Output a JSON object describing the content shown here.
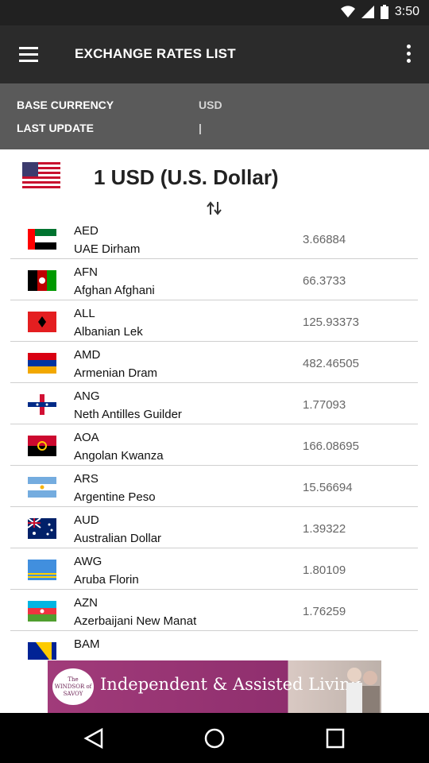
{
  "status_bar": {
    "time": "3:50"
  },
  "toolbar": {
    "title": "EXCHANGE RATES LIST",
    "menu_icon": "hamburger-menu-icon",
    "overflow_icon": "more-vert-icon"
  },
  "info": {
    "base_currency_label": "BASE CURRENCY",
    "base_currency_value": "USD",
    "last_update_label": "LAST UPDATE",
    "last_update_value": "|"
  },
  "base": {
    "title": "1 USD (U.S. Dollar)",
    "flag_icon": "us-flag-icon",
    "swap_icon": "swap-vertical-icon"
  },
  "rates": [
    {
      "code": "AED",
      "name": "UAE Dirham",
      "rate": "3.66884",
      "flag_icon": "uae-flag-icon"
    },
    {
      "code": "AFN",
      "name": "Afghan Afghani",
      "rate": "66.3733",
      "flag_icon": "afghanistan-flag-icon"
    },
    {
      "code": "ALL",
      "name": "Albanian Lek",
      "rate": "125.93373",
      "flag_icon": "albania-flag-icon"
    },
    {
      "code": "AMD",
      "name": "Armenian Dram",
      "rate": "482.46505",
      "flag_icon": "armenia-flag-icon"
    },
    {
      "code": "ANG",
      "name": "Neth Antilles Guilder",
      "rate": "1.77093",
      "flag_icon": "netherlands-antilles-flag-icon"
    },
    {
      "code": "AOA",
      "name": "Angolan Kwanza",
      "rate": "166.08695",
      "flag_icon": "angola-flag-icon"
    },
    {
      "code": "ARS",
      "name": "Argentine Peso",
      "rate": "15.56694",
      "flag_icon": "argentina-flag-icon"
    },
    {
      "code": "AUD",
      "name": "Australian Dollar",
      "rate": "1.39322",
      "flag_icon": "australia-flag-icon"
    },
    {
      "code": "AWG",
      "name": "Aruba Florin",
      "rate": "1.80109",
      "flag_icon": "aruba-flag-icon"
    },
    {
      "code": "AZN",
      "name": "Azerbaijani New Manat",
      "rate": "1.76259",
      "flag_icon": "azerbaijan-flag-icon"
    },
    {
      "code": "BAM",
      "name": "",
      "rate": "",
      "flag_icon": "bosnia-flag-icon"
    }
  ],
  "ad": {
    "logo": "The WINDSOR of SAVOY",
    "text": "Independent & Assisted Living"
  },
  "nav": {
    "back_icon": "back-triangle-icon",
    "home_icon": "home-circle-icon",
    "recents_icon": "recents-square-icon"
  },
  "colors": {
    "toolbar": "#2b2b2b",
    "info_panel": "#5a5a5a",
    "ad_purple": "#a13b7a"
  }
}
